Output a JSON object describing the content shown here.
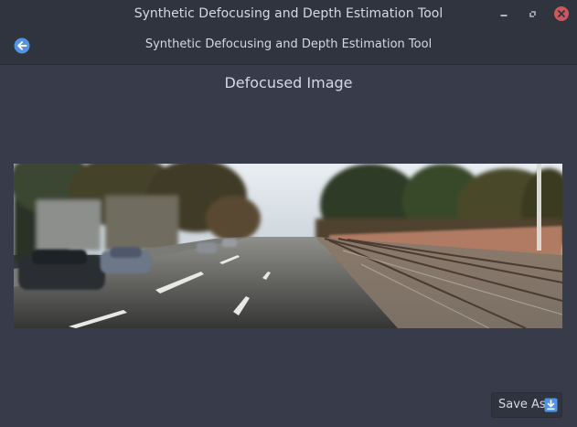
{
  "window": {
    "title": "Synthetic Defocusing and Depth Estimation Tool"
  },
  "header": {
    "subtitle": "Synthetic Defocusing and Depth Estimation Tool"
  },
  "main": {
    "section_title": "Defocused Image",
    "image_description": "street scene with trees, parked cars, road and railway tracks"
  },
  "actions": {
    "save_as_label": "Save As"
  },
  "colors": {
    "window_bg": "#383c4a",
    "titlebar_bg": "#2f343f",
    "text": "#d3dae3",
    "accent_blue": "#5294e2",
    "close_red": "#cc575d"
  }
}
